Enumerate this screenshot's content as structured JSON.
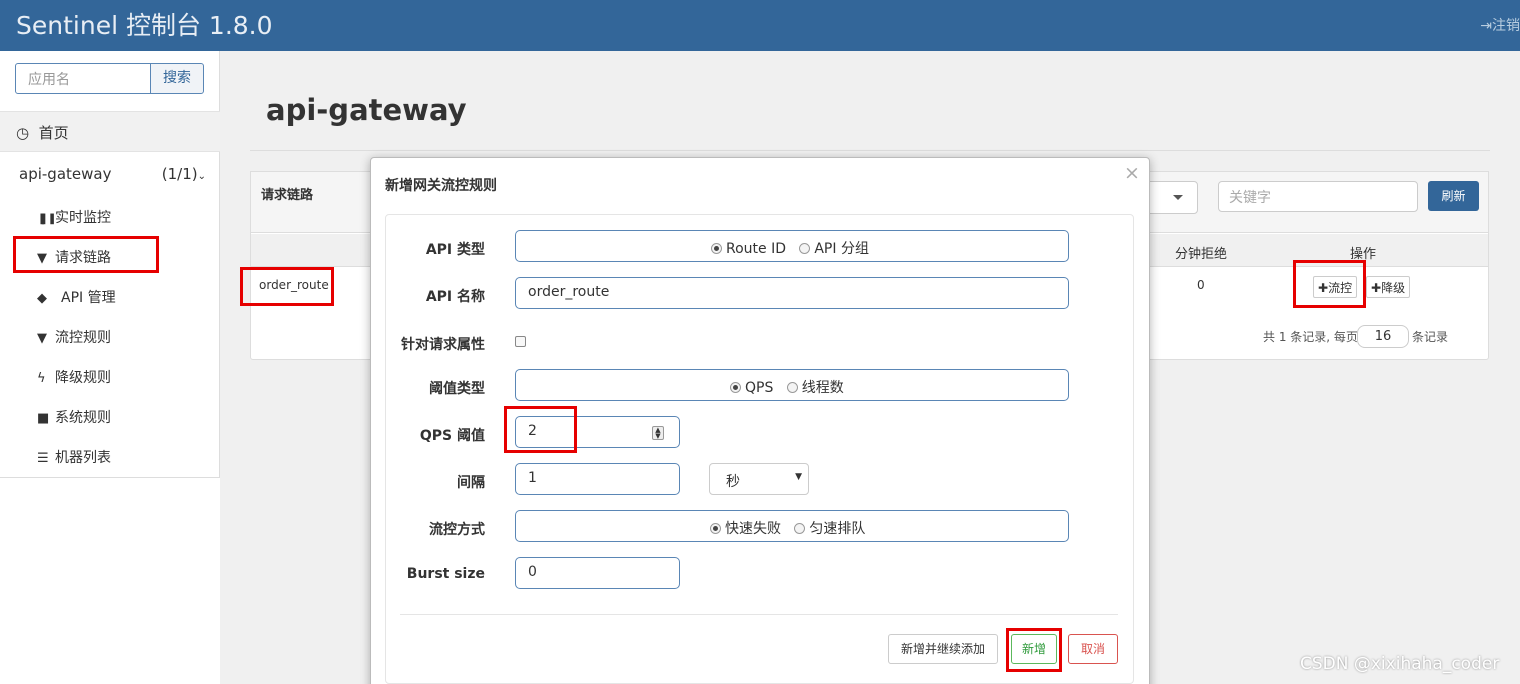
{
  "app": {
    "title": "Sentinel 控制台 1.8.0",
    "logout": "注销"
  },
  "sidebar": {
    "search_placeholder": "应用名",
    "search_button": "搜索",
    "home": "首页",
    "app_name": "api-gateway",
    "app_count": "(1/1)",
    "items": [
      {
        "icon": "bar-chart-icon",
        "glyph": "▐▐",
        "label": "实时监控"
      },
      {
        "icon": "filter-icon",
        "glyph": "▼",
        "label": "请求链路"
      },
      {
        "icon": "tags-icon",
        "glyph": "◆",
        "label": "API 管理"
      },
      {
        "icon": "filter-icon",
        "glyph": "▼",
        "label": "流控规则"
      },
      {
        "icon": "flash-icon",
        "glyph": "ϟ",
        "label": "降级规则"
      },
      {
        "icon": "lock-icon",
        "glyph": "■",
        "label": "系统规则"
      },
      {
        "icon": "list-icon",
        "glyph": "☰",
        "label": "机器列表"
      }
    ]
  },
  "main": {
    "page_title": "api-gateway",
    "panel_title": "请求链路",
    "keyword_placeholder": "关键字",
    "refresh_button": "刷新",
    "columns": {
      "reject": "分钟拒绝",
      "ops": "操作"
    },
    "row": {
      "resource": "order_route",
      "reject": "0",
      "flow_button": "流控",
      "degrade_button": "降级"
    },
    "pager": {
      "prefix": "共 1 条记录, 每页",
      "page_size": "16",
      "suffix": "条记录"
    }
  },
  "modal": {
    "title": "新增网关流控规则",
    "close": "×",
    "api_type": {
      "label": "API 类型",
      "options": [
        "Route ID",
        "API 分组"
      ],
      "selected": "Route ID"
    },
    "api_name": {
      "label": "API 名称",
      "value": "order_route"
    },
    "param_attr": {
      "label": "针对请求属性",
      "checked": false
    },
    "grade": {
      "label": "阈值类型",
      "options": [
        "QPS",
        "线程数"
      ],
      "selected": "QPS"
    },
    "threshold": {
      "label": "QPS 阈值",
      "value": "2"
    },
    "interval": {
      "label": "间隔",
      "value": "1",
      "unit": "秒"
    },
    "control_behavior": {
      "label": "流控方式",
      "options": [
        "快速失败",
        "匀速排队"
      ],
      "selected": "快速失败"
    },
    "burst": {
      "label": "Burst size",
      "value": "0"
    },
    "buttons": {
      "add_continue": "新增并继续添加",
      "add": "新增",
      "cancel": "取消"
    }
  },
  "colors": {
    "navbar": "#336699",
    "highlight": "#e60000",
    "add_text": "#2e9a3a",
    "cancel_text": "#d9534f"
  },
  "watermark": "CSDN @xixihaha_coder"
}
